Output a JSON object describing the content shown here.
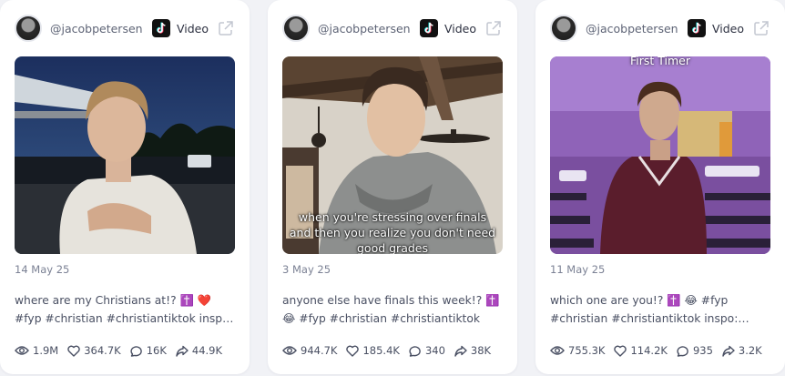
{
  "cards": [
    {
      "username": "@jacobpetersen",
      "type_label": "Video",
      "thumb_caption": "",
      "thumb_title": "",
      "date": "14 May 25",
      "caption": "where are my Christians at!? ✝️ ❤️ #fyp #christian #christiantiktok inspo: @gracie",
      "stats": {
        "views": "1.9M",
        "likes": "364.7K",
        "comments": "16K",
        "shares": "44.9K"
      }
    },
    {
      "username": "@jacobpetersen",
      "type_label": "Video",
      "thumb_caption": "when you're stressing over finals and then you realize you don't need good grades",
      "thumb_title": "",
      "date": "3 May 25",
      "caption": "anyone else have finals this week!? ✝️ 😂 #fyp #christian #christiantiktok",
      "stats": {
        "views": "944.7K",
        "likes": "185.4K",
        "comments": "340",
        "shares": "38K"
      }
    },
    {
      "username": "@jacobpetersen",
      "type_label": "Video",
      "thumb_caption": "",
      "thumb_title": "First Timer",
      "date": "11 May 25",
      "caption": "which one are you!? ✝️ 😂 #fyp #christian #christiantiktok inspo: @gracie",
      "stats": {
        "views": "755.3K",
        "likes": "114.2K",
        "comments": "935",
        "shares": "3.2K"
      }
    }
  ]
}
